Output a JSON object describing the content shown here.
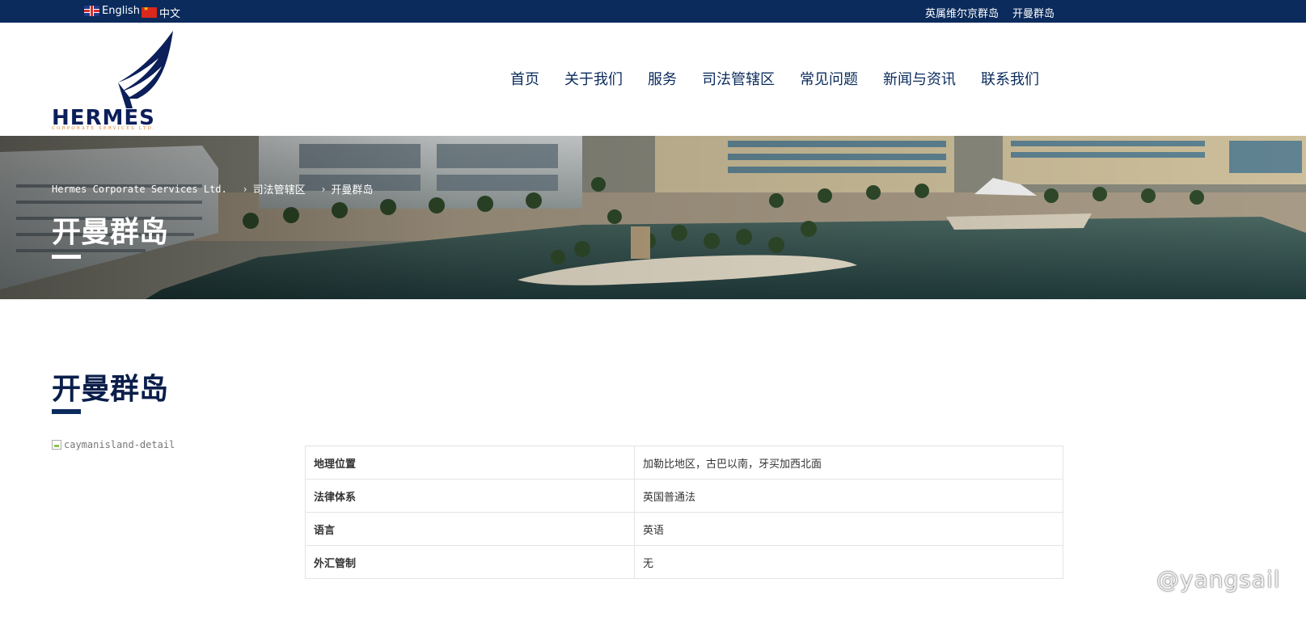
{
  "topbar": {
    "lang_en": "English",
    "lang_zh": "中文",
    "link_bvi": "英属维尔京群岛",
    "link_cayman": "开曼群岛"
  },
  "header": {
    "logo_name": "HERMES",
    "logo_subtitle": "CORPORATE SERVICES LTD.",
    "nav": [
      "首页",
      "关于我们",
      "服务",
      "司法管辖区",
      "常见问题",
      "新闻与资讯",
      "联系我们"
    ]
  },
  "banner": {
    "breadcrumb": [
      "Hermes Corporate Services Ltd.",
      "司法管辖区",
      "开曼群岛"
    ],
    "title": "开曼群岛"
  },
  "content": {
    "title": "开曼群岛",
    "image_alt": "caymanisland-detail",
    "table": [
      {
        "key": "地理位置",
        "value": "加勒比地区，古巴以南，牙买加西北面"
      },
      {
        "key": "法律体系",
        "value": "英国普通法"
      },
      {
        "key": "语言",
        "value": "英语"
      },
      {
        "key": "外汇管制",
        "value": "无"
      }
    ]
  },
  "watermark": "@yangsail",
  "colors": {
    "brand_navy": "#0a2b5c",
    "logo_orange": "#e07a1f"
  }
}
